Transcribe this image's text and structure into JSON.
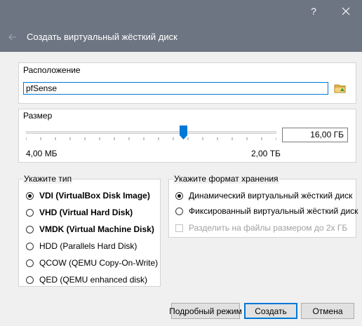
{
  "window": {
    "title": "Создать виртуальный жёсткий диск",
    "help_glyph": "?",
    "close_glyph": "✕"
  },
  "location": {
    "label": "Расположение",
    "value": "pfSense"
  },
  "size": {
    "label": "Размер",
    "value": "16,00 ГБ",
    "min_label": "4,00 МБ",
    "max_label": "2,00 ТБ",
    "slider_fraction": 0.63
  },
  "disk_type": {
    "label": "Укажите тип",
    "options": [
      {
        "label": "VDI (VirtualBox Disk Image)",
        "selected": true,
        "bold": true
      },
      {
        "label": "VHD (Virtual Hard Disk)",
        "selected": false,
        "bold": true
      },
      {
        "label": "VMDK (Virtual Machine Disk)",
        "selected": false,
        "bold": true
      },
      {
        "label": "HDD (Parallels Hard Disk)",
        "selected": false,
        "bold": false
      },
      {
        "label": "QCOW (QEMU Copy-On-Write)",
        "selected": false,
        "bold": false
      },
      {
        "label": "QED (QEMU enhanced disk)",
        "selected": false,
        "bold": false
      }
    ]
  },
  "storage": {
    "label": "Укажите формат хранения",
    "dynamic_label": "Динамический виртуальный жёсткий диск",
    "fixed_label": "Фиксированный виртуальный жёсткий диск",
    "split_label": "Разделить на файлы размером до 2х ГБ",
    "dynamic_selected": true
  },
  "buttons": {
    "expert": "Подробный режим",
    "create": "Создать",
    "cancel": "Отмена"
  },
  "colors": {
    "titlebar": "#6d7582",
    "accent": "#0078d7"
  }
}
